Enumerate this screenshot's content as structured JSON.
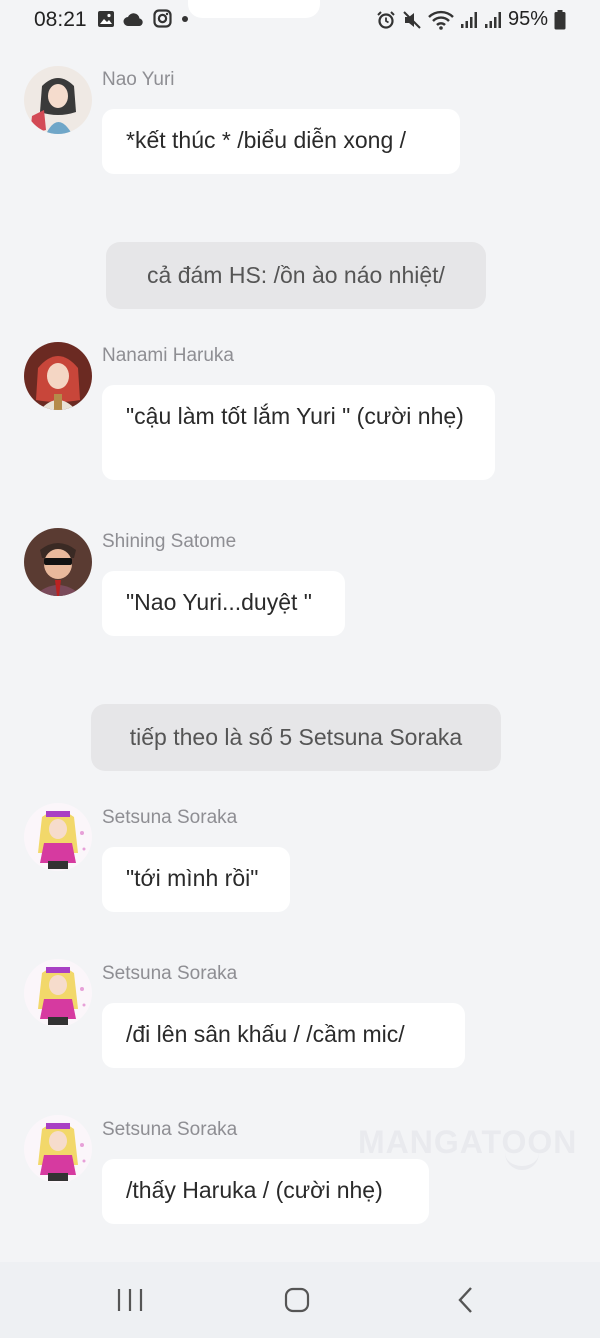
{
  "status_bar": {
    "time": "08:21",
    "battery": "95%",
    "notification_icons": [
      "image-icon",
      "cloud-icon",
      "instagram-icon",
      "dot-icon"
    ],
    "system_icons": [
      "alarm-icon",
      "mute-icon",
      "wifi-icon",
      "signal-icon",
      "signal-icon",
      "battery-icon"
    ]
  },
  "messages": [
    {
      "sender": "Nao Yuri",
      "text": "*kết thúc * /biểu diễn xong /"
    },
    {
      "narration": "cả đám HS: /ồn ào náo nhiệt/"
    },
    {
      "sender": "Nanami Haruka",
      "text": "\"cậu làm tốt lắm Yuri \" (cười nhẹ)"
    },
    {
      "sender": "Shining Satome",
      "text": "\"Nao Yuri...duyệt \""
    },
    {
      "narration": "tiếp theo là số 5 Setsuna Soraka"
    },
    {
      "sender": "Setsuna Soraka",
      "text": "\"tới mình rồi\""
    },
    {
      "sender": "Setsuna Soraka",
      "text": "/đi lên sân khấu / /cầm mic/"
    },
    {
      "sender": "Setsuna Soraka",
      "text": "/thấy Haruka / (cười nhẹ)"
    }
  ],
  "watermark": "MANGATOON",
  "nav_bar": {
    "buttons": [
      "recent-apps-icon",
      "home-icon",
      "back-icon"
    ]
  },
  "colors": {
    "background": "#f3f4f6",
    "bubble": "#ffffff",
    "narration_bubble": "#e6e6e8",
    "sender_name": "#8e8e93"
  }
}
